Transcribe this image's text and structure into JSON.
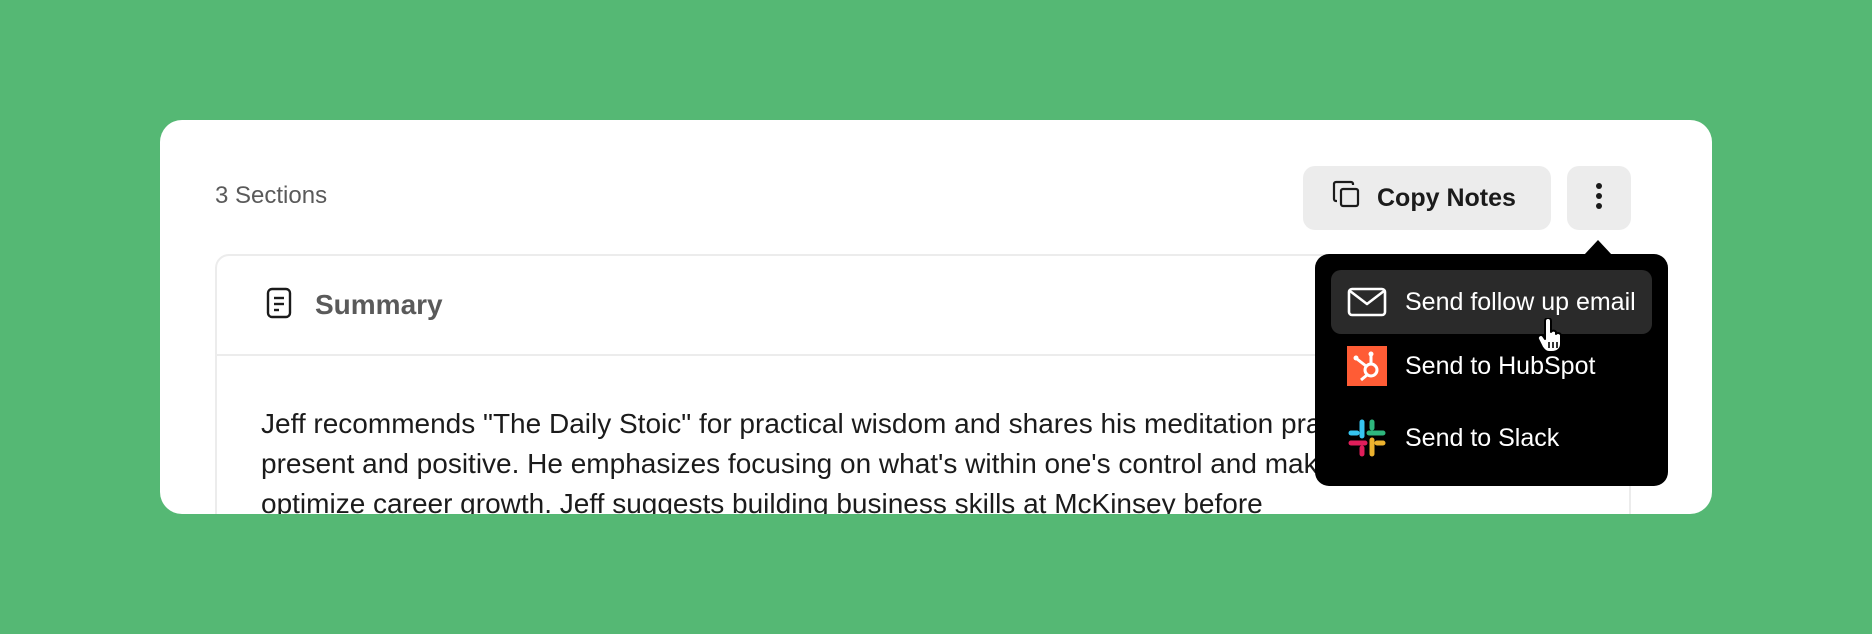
{
  "header": {
    "sections_count": "3 Sections",
    "copy_notes_label": "Copy Notes"
  },
  "section": {
    "title": "Summary",
    "body": "Jeff recommends \"The Daily Stoic\" for practical wisdom and shares his meditation practice for staying present and positive. He emphasizes focusing on what's within one's control and making choices to optimize career growth. Jeff suggests building business skills at McKinsey before"
  },
  "menu": {
    "items": [
      {
        "label": "Send follow up email",
        "icon": "mail-icon"
      },
      {
        "label": "Send to HubSpot",
        "icon": "hubspot-icon"
      },
      {
        "label": "Send to Slack",
        "icon": "slack-icon"
      }
    ]
  },
  "colors": {
    "background": "#55b874",
    "menu_bg": "#000000",
    "hubspot": "#ff5c35"
  }
}
